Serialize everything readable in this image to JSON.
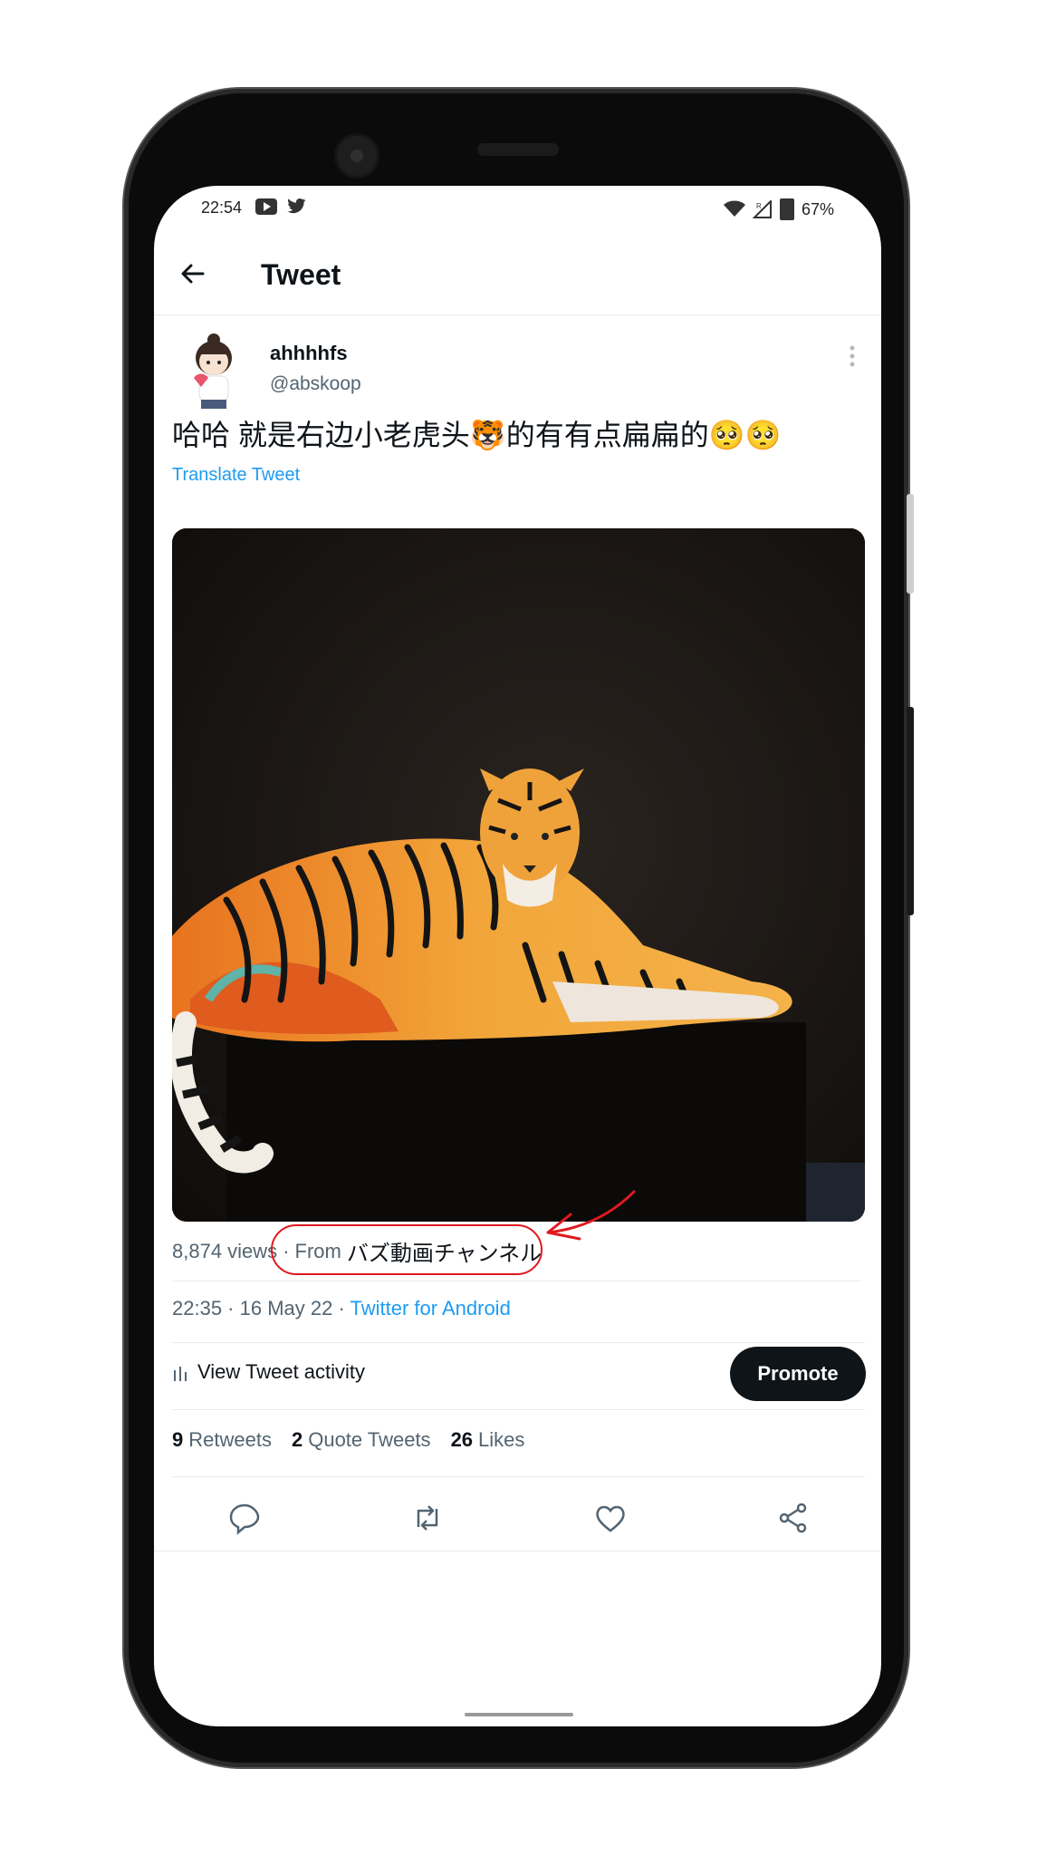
{
  "status_bar": {
    "time": "22:54",
    "battery": "67%",
    "network": "R"
  },
  "header": {
    "title": "Tweet"
  },
  "tweet": {
    "author_name": "ahhhhfs",
    "author_handle": "@abskoop",
    "text": "哈哈 就是右边小老虎头🐯的有有点扁扁的🥺🥺",
    "translate_label": "Translate Tweet",
    "views": "8,874 views",
    "separator": "·",
    "from_label": "From",
    "from_name": "バズ動画チャンネル",
    "datetime": "22:35 · 16 May 22 · ",
    "client": "Twitter for Android",
    "activity_label": "View Tweet activity",
    "promote_label": "Promote",
    "stats": {
      "retweets_count": "9",
      "retweets_label": "Retweets",
      "quotes_count": "2",
      "quotes_label": "Quote Tweets",
      "likes_count": "26",
      "likes_label": "Likes"
    }
  },
  "icons": [
    "back-arrow-icon",
    "more-vert-icon",
    "reply-icon",
    "retweet-icon",
    "like-icon",
    "share-icon",
    "chart-bars-icon"
  ],
  "colors": {
    "accent": "#1d9bf0",
    "text": "#0f1419",
    "muted": "#536471",
    "annotation": "#e0191f"
  }
}
